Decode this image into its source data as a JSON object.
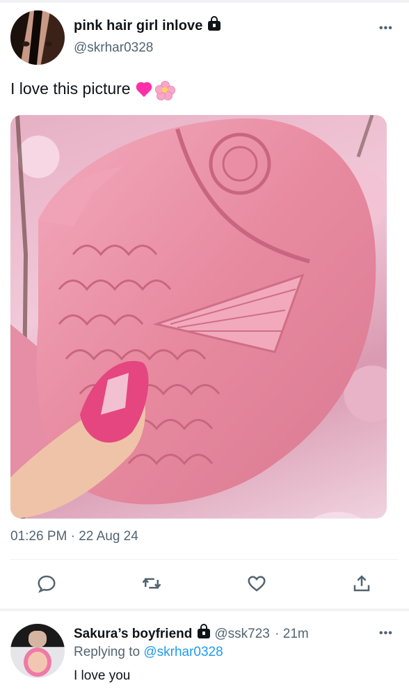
{
  "main_tweet": {
    "display_name": "pink hair girl inlove",
    "handle": "@skrhar0328",
    "text": "I love this picture",
    "emojis": [
      "pink-heart",
      "cherry-blossom"
    ],
    "timestamp": "01:26 PM · 22 Aug 24",
    "photo_description_icon": "pink-fish-shaped-ice-cream-photo"
  },
  "actions": [
    "reply-icon",
    "retweet-icon",
    "like-icon",
    "share-icon"
  ],
  "reply": {
    "display_name": "Sakura’s boyfriend",
    "handle": "@ssk723",
    "time": "· 21m",
    "replying_label": "Replying to",
    "replying_to": "@skrhar0328",
    "text": "I love you"
  },
  "colors": {
    "text": "#0f1419",
    "secondary": "#536471",
    "link": "#1d9bf0",
    "divider": "#eff3f4"
  }
}
